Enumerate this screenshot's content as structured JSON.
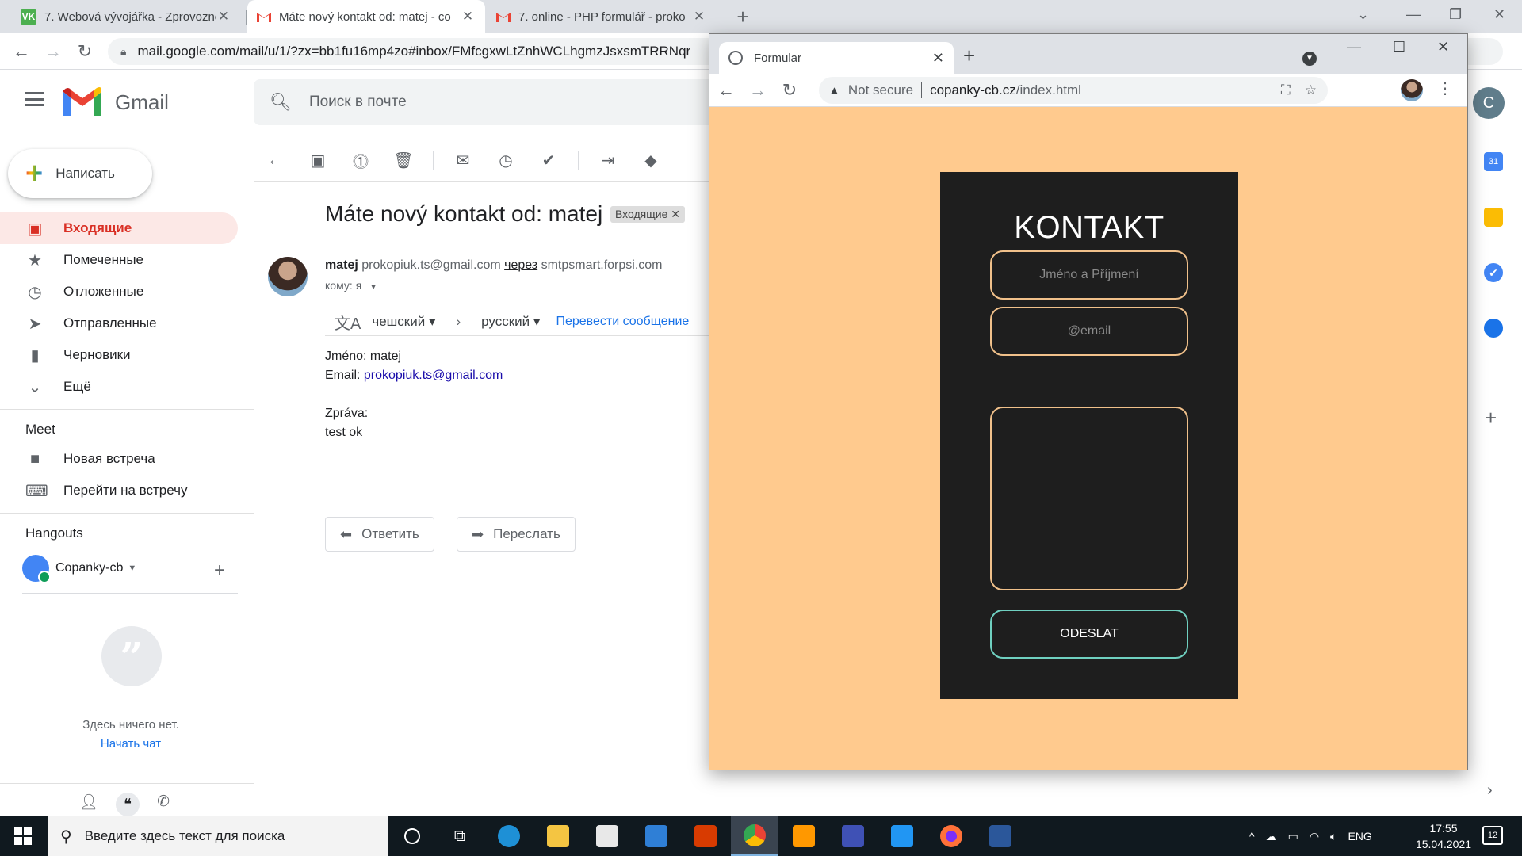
{
  "browser": {
    "tabs": [
      {
        "title": "7. Webová vývojářka - Zprovozně",
        "icon": "vk-favicon",
        "active": false
      },
      {
        "title": "Máte nový kontakt od: matej - co",
        "icon": "gmail-favicon",
        "active": true
      },
      {
        "title": "7. online - PHP formulář - proko",
        "icon": "gmail-favicon",
        "active": false
      }
    ],
    "url": "mail.google.com/mail/u/1/?zx=bb1fu16mp4zo#inbox/FMfcgxwLtZnhWCLhgmzJsxsmTRRNqr"
  },
  "gmail": {
    "brand": "Gmail",
    "search_placeholder": "Поиск в почте",
    "account_initial": "C",
    "compose_label": "Написать",
    "nav": [
      {
        "label": "Входящие",
        "icon": "inbox-icon",
        "active": true
      },
      {
        "label": "Помеченные",
        "icon": "star-icon",
        "active": false
      },
      {
        "label": "Отложенные",
        "icon": "clock-icon",
        "active": false
      },
      {
        "label": "Отправленные",
        "icon": "send-icon",
        "active": false
      },
      {
        "label": "Черновики",
        "icon": "draft-icon",
        "active": false
      },
      {
        "label": "Ещё",
        "icon": "chevron-down-icon",
        "active": false
      }
    ],
    "meet": {
      "title": "Meet",
      "items": [
        {
          "label": "Новая встреча",
          "icon": "video-icon"
        },
        {
          "label": "Перейти на встречу",
          "icon": "keyboard-icon"
        }
      ]
    },
    "hangouts": {
      "title": "Hangouts",
      "user": "Copanky-cb",
      "empty_text": "Здесь ничего нет.",
      "start_chat": "Начать чат"
    },
    "message": {
      "subject": "Máte nový kontakt od: matej",
      "label": "Входящие",
      "sender_name": "matej",
      "sender_email": "prokopiuk.ts@gmail.com",
      "via_label": "через",
      "via_domain": "smtpsmart.forpsi.com",
      "to_label": "кому: я",
      "translate": {
        "from_lang": "чешский",
        "to_lang": "русский",
        "action": "Перевести сообщение"
      },
      "body": {
        "name_line": "Jméno: matej",
        "email_label": "Email:",
        "email_link": "prokopiuk.ts@gmail.com",
        "message_label": "Zpráva:",
        "message_text": "test ok"
      },
      "reply_label": "Ответить",
      "forward_label": "Переслать"
    }
  },
  "popup": {
    "tab_title": "Formular",
    "security": "Not secure",
    "url_domain": "copanky-cb.cz",
    "url_path": "/index.html",
    "form": {
      "title": "KONTAKT",
      "name_placeholder": "Jméno a Příjmení",
      "email_placeholder": "@email",
      "submit_label": "ODESLAT"
    },
    "colors": {
      "page_bg": "#ffca8e",
      "card_bg": "#1e1e1e",
      "input_border": "#f0c08a",
      "submit_border": "#6fd0c0"
    }
  },
  "taskbar": {
    "search_placeholder": "Введите здесь текст для поиска",
    "language": "ENG",
    "time": "17:55",
    "date": "15.04.2021",
    "notifications": "12"
  }
}
